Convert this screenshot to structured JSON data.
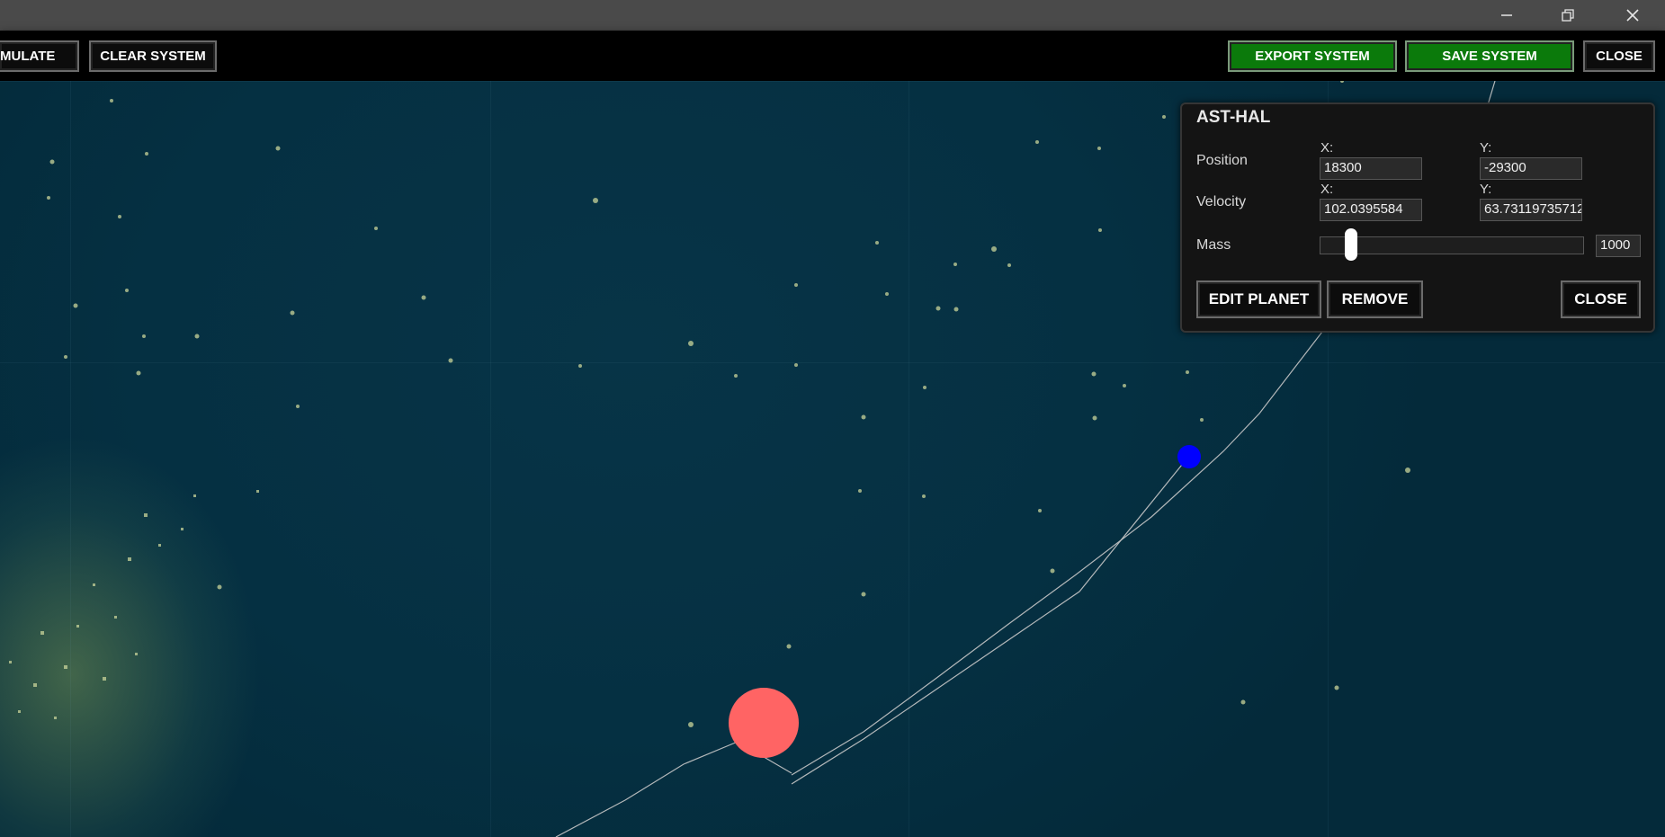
{
  "toolbar": {
    "simulate_label": "MULATE",
    "clear_label": "CLEAR SYSTEM",
    "export_label": "EXPORT SYSTEM",
    "save_label": "SAVE SYSTEM",
    "close_label": "CLOSE",
    "accent_green": "#0b7a0b"
  },
  "window_controls": {
    "minimize_icon": "minimize-icon",
    "restore_icon": "restore-icon",
    "close_icon": "close-icon"
  },
  "panel": {
    "title": "AST-HAL",
    "position_label": "Position",
    "velocity_label": "Velocity",
    "mass_label": "Mass",
    "x_label": "X:",
    "y_label": "Y:",
    "position_x": "18300",
    "position_y": "-29300",
    "velocity_x": "102.0395584",
    "velocity_y": "63.73119735712",
    "mass_value": "1000",
    "mass_slider_fraction": 0.1,
    "edit_label": "EDIT PLANET",
    "remove_label": "REMOVE",
    "close_label": "CLOSE"
  },
  "scene": {
    "star_color": "#ff6464",
    "planet_color": "#0000ff",
    "orbit_color": "#c8c8c8"
  }
}
